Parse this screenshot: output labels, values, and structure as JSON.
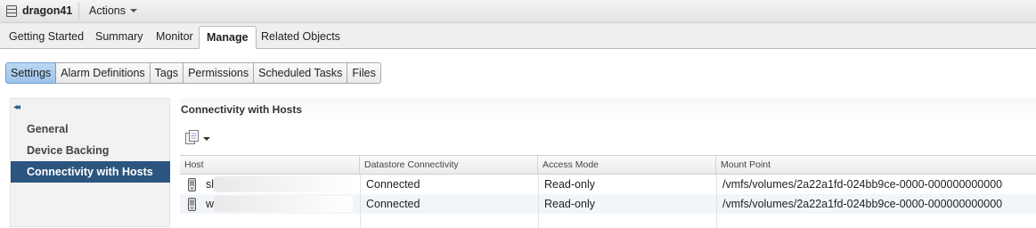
{
  "header": {
    "object_name": "dragon41",
    "actions_label": "Actions"
  },
  "main_tabs": [
    {
      "label": "Getting Started"
    },
    {
      "label": "Summary"
    },
    {
      "label": "Monitor"
    },
    {
      "label": "Manage"
    },
    {
      "label": "Related Objects"
    }
  ],
  "sub_tabs": [
    {
      "label": "Settings"
    },
    {
      "label": "Alarm Definitions"
    },
    {
      "label": "Tags"
    },
    {
      "label": "Permissions"
    },
    {
      "label": "Scheduled Tasks"
    },
    {
      "label": "Files"
    }
  ],
  "left_nav": {
    "collapse_glyph": "◂◂",
    "items": [
      {
        "label": "General"
      },
      {
        "label": "Device Backing"
      },
      {
        "label": "Connectivity with Hosts"
      }
    ]
  },
  "panel": {
    "title": "Connectivity with Hosts",
    "table": {
      "columns": [
        "Host",
        "Datastore Connectivity",
        "Access Mode",
        "Mount Point"
      ],
      "rows": [
        {
          "host": "sl",
          "connectivity": "Connected",
          "access_mode": "Read-only",
          "mount_point": "/vmfs/volumes/2a22a1fd-024bb9ce-0000-000000000000"
        },
        {
          "host": "w",
          "connectivity": "Connected",
          "access_mode": "Read-only",
          "mount_point": "/vmfs/volumes/2a22a1fd-024bb9ce-0000-000000000000"
        }
      ]
    }
  },
  "colors": {
    "active_nav": "#2c5580",
    "active_subtab": "#9cc3ea",
    "alt_row": "#f1f5fa"
  },
  "icons": [
    "datastore-icon",
    "dropdown-caret-icon",
    "collapse-icon",
    "export-icon",
    "host-server-icon"
  ]
}
